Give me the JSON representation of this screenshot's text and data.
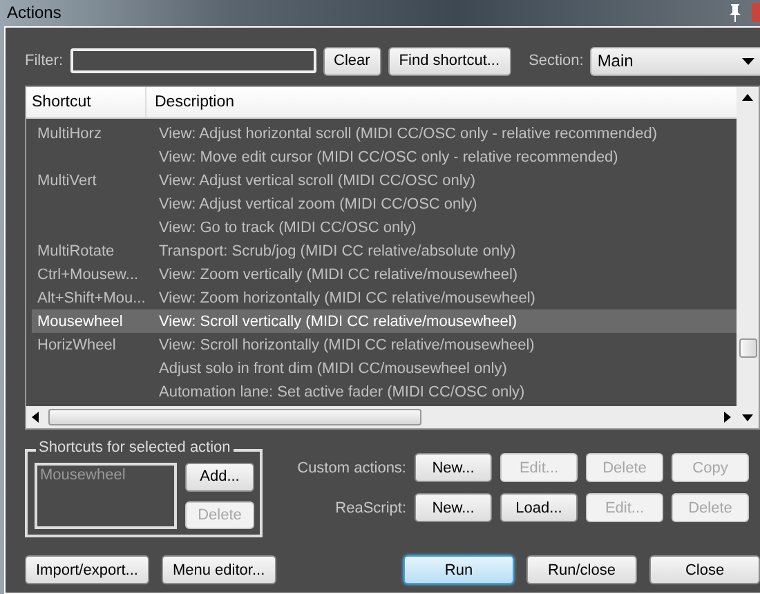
{
  "window": {
    "title": "Actions"
  },
  "filter": {
    "label": "Filter:"
  },
  "top_buttons": [
    {
      "label": "Clear",
      "disabled": false
    },
    {
      "label": "Find shortcut...",
      "disabled": false
    }
  ],
  "section": {
    "label": "Section:",
    "value": "Main"
  },
  "table": {
    "columns": [
      "Shortcut",
      "Description"
    ],
    "rows": [
      {
        "shortcut": "MultiHorz",
        "description": "View: Adjust horizontal scroll (MIDI CC/OSC only - relative recommended)",
        "selected": false
      },
      {
        "description": "View: Move edit cursor (MIDI CC/OSC only - relative recommended)",
        "selected": false
      },
      {
        "shortcut": "MultiVert",
        "description": "View: Adjust vertical scroll (MIDI CC/OSC only)",
        "selected": false
      },
      {
        "description": "View: Adjust vertical zoom (MIDI CC/OSC only)",
        "selected": false
      },
      {
        "description": "View: Go to track (MIDI CC/OSC only)",
        "selected": false
      },
      {
        "shortcut": "MultiRotate",
        "description": "Transport: Scrub/jog (MIDI CC relative/absolute only)",
        "selected": false
      },
      {
        "shortcut": "Ctrl+Mousew...",
        "description": "View: Zoom vertically (MIDI CC relative/mousewheel)",
        "selected": false
      },
      {
        "shortcut": "Alt+Shift+Mou...",
        "description": "View: Zoom horizontally (MIDI CC relative/mousewheel)",
        "selected": false
      },
      {
        "shortcut": "Mousewheel",
        "description": "View: Scroll vertically (MIDI CC relative/mousewheel)",
        "selected": true
      },
      {
        "shortcut": "HorizWheel",
        "description": "View: Scroll horizontally (MIDI CC relative/mousewheel)",
        "selected": false
      },
      {
        "description": "Adjust solo in front dim (MIDI CC/mousewheel only)",
        "selected": false
      },
      {
        "description": "Automation lane: Set active fader (MIDI CC/OSC only)",
        "selected": false
      }
    ]
  },
  "shortcuts_group": {
    "title": "Shortcuts for selected action",
    "items": [
      "Mousewheel"
    ],
    "buttons": [
      {
        "label": "Add...",
        "disabled": false
      },
      {
        "label": "Delete",
        "disabled": true
      }
    ]
  },
  "custom_actions": {
    "label": "Custom actions:",
    "buttons": [
      {
        "label": "New...",
        "disabled": false
      },
      {
        "label": "Edit...",
        "disabled": true
      },
      {
        "label": "Delete",
        "disabled": true
      },
      {
        "label": "Copy",
        "disabled": true
      }
    ]
  },
  "reascript": {
    "label": "ReaScript:",
    "buttons": [
      {
        "label": "New...",
        "disabled": false
      },
      {
        "label": "Load...",
        "disabled": false
      },
      {
        "label": "Edit...",
        "disabled": true
      },
      {
        "label": "Delete",
        "disabled": true
      }
    ]
  },
  "bottom_left": [
    {
      "label": "Import/export...",
      "disabled": false
    },
    {
      "label": "Menu editor...",
      "disabled": false
    }
  ],
  "bottom_right": [
    {
      "label": "Run",
      "disabled": false,
      "focused": true
    },
    {
      "label": "Run/close",
      "disabled": false,
      "focused": false
    },
    {
      "label": "Close",
      "disabled": false,
      "focused": false
    }
  ]
}
